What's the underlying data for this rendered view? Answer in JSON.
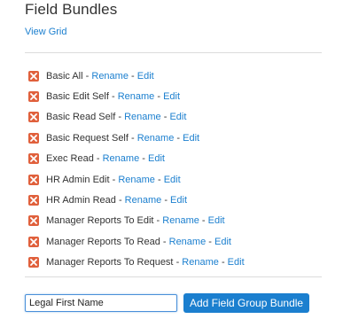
{
  "header": {
    "title": "Field Bundles",
    "view_grid_label": "View Grid"
  },
  "bundles": [
    {
      "name": "Basic All",
      "rename": "Rename",
      "edit": "Edit"
    },
    {
      "name": "Basic Edit Self",
      "rename": "Rename",
      "edit": "Edit"
    },
    {
      "name": "Basic Read Self",
      "rename": "Rename",
      "edit": "Edit"
    },
    {
      "name": "Basic Request Self",
      "rename": "Rename",
      "edit": "Edit"
    },
    {
      "name": "Exec Read",
      "rename": "Rename",
      "edit": "Edit"
    },
    {
      "name": "HR Admin Edit",
      "rename": "Rename",
      "edit": "Edit"
    },
    {
      "name": "HR Admin Read",
      "rename": "Rename",
      "edit": "Edit"
    },
    {
      "name": "Manager Reports To Edit",
      "rename": "Rename",
      "edit": "Edit"
    },
    {
      "name": "Manager Reports To Read",
      "rename": "Rename",
      "edit": "Edit"
    },
    {
      "name": "Manager Reports To Request",
      "rename": "Rename",
      "edit": "Edit"
    }
  ],
  "separator": "-",
  "icons": {
    "remove": "close-icon"
  },
  "add_form": {
    "input_value": "Legal First Name",
    "button_label": "Add Field Group Bundle"
  },
  "colors": {
    "link": "#1b7fcf",
    "remove_icon": "#e0603c",
    "button": "#1b7fcf"
  }
}
